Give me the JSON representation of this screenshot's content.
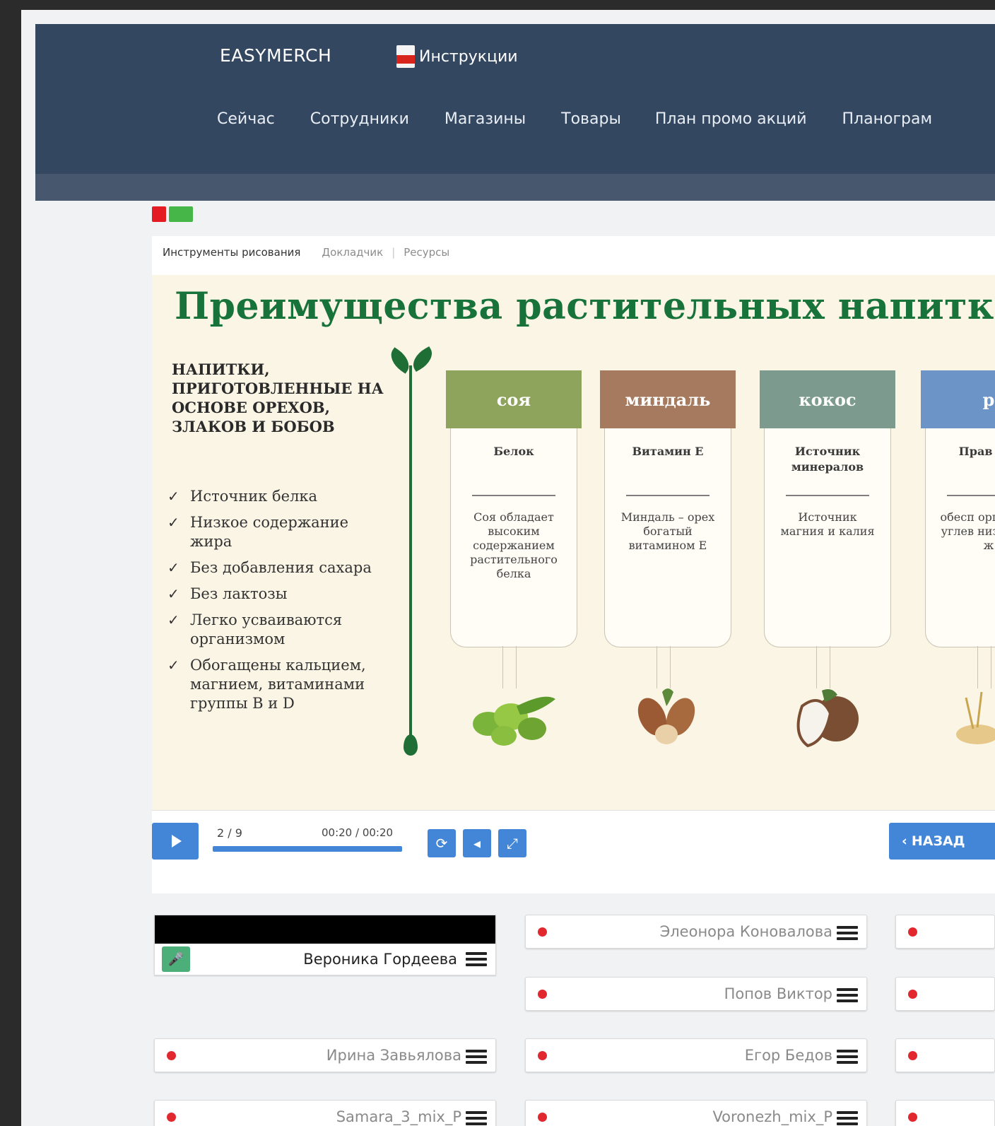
{
  "header": {
    "brand": "EASYMERCH",
    "instructions_link": "Инструкции",
    "nav": [
      "Сейчас",
      "Сотрудники",
      "Магазины",
      "Товары",
      "План промо акций",
      "Планограм"
    ]
  },
  "presentation": {
    "tabs": {
      "drawing_tools": "Инструменты рисования",
      "speaker": "Докладчик",
      "resources": "Ресурсы"
    },
    "slide": {
      "title": "Преимущества растительных напитков",
      "subtitle": "НАПИТКИ, ПРИГОТОВЛЕННЫЕ НА ОСНОВЕ ОРЕХОВ, ЗЛАКОВ И БОБОВ",
      "benefits": [
        "Источник белка",
        "Низкое содержание жира",
        "Без добавления сахара",
        "Без лактозы",
        "Легко усваиваются организмом",
        "Обогащены кальцием, магнием, витаминами группы В и D"
      ],
      "columns": [
        {
          "name": "СОЯ",
          "key": "Белок",
          "desc": "Соя обладает высоким содержанием растительного белка",
          "color": "#8ea35c"
        },
        {
          "name": "МИНДАЛЬ",
          "key": "Витамин Е",
          "desc": "Миндаль – орех богатый витамином Е",
          "color": "#a57a5e"
        },
        {
          "name": "КОКОС",
          "key": "Источник минералов",
          "desc": "Источник магния и калия",
          "color": "#7c9a8d"
        },
        {
          "name": "Р",
          "key": "Прав угл",
          "desc": "обесп орг парал углев низ содер ж",
          "color": "#6d94c7"
        }
      ]
    },
    "player": {
      "slide_counter": "2 / 9",
      "time": "00:20 / 00:20",
      "progress": 1.0,
      "back_label": "НАЗАД"
    }
  },
  "participants": {
    "self": "Вероника Гордеева",
    "list": [
      "Элеонора Коновалова",
      "Попов Виктор",
      "Ирина Завьялова",
      "Егор Бедов",
      "Samara_3_mix_P",
      "Voronezh_mix_P"
    ]
  }
}
